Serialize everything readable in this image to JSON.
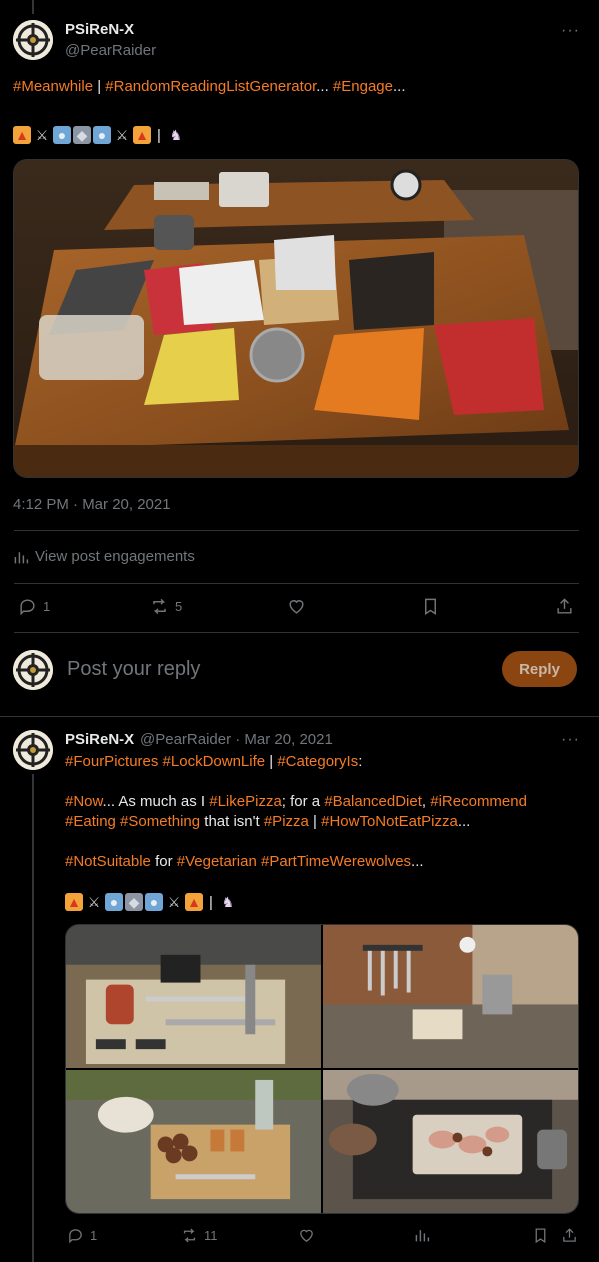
{
  "main_post": {
    "display_name": "PSiReN-X",
    "handle": "@PearRaider",
    "text_line1": [
      {
        "t": "#Meanwhile",
        "tag": true
      },
      {
        "t": " | ",
        "tag": false
      },
      {
        "t": "#RandomReadingListGenerator",
        "tag": true
      },
      {
        "t": "... ",
        "tag": false
      },
      {
        "t": "#Engage",
        "tag": true
      },
      {
        "t": "...",
        "tag": false
      }
    ],
    "timestamp": "4:12 PM · Mar 20, 2021",
    "engagements_label": "View post engagements",
    "reply_count": "1",
    "repost_count": "5"
  },
  "reply_box": {
    "placeholder": "Post your reply",
    "button_label": "Reply"
  },
  "reply_post": {
    "display_name": "PSiReN-X",
    "handle_date": "@PearRaider · Mar 20, 2021",
    "line1": [
      {
        "t": "#FourPictures",
        "tag": true
      },
      {
        "t": " ",
        "tag": false
      },
      {
        "t": "#LockDownLife",
        "tag": true
      },
      {
        "t": " | ",
        "tag": false
      },
      {
        "t": "#CategoryIs",
        "tag": true
      },
      {
        "t": ":",
        "tag": false
      }
    ],
    "line2": [
      {
        "t": "#Now",
        "tag": true
      },
      {
        "t": "... As much as I ",
        "tag": false
      },
      {
        "t": "#LikePizza",
        "tag": true
      },
      {
        "t": "; for a ",
        "tag": false
      },
      {
        "t": "#BalancedDiet",
        "tag": true
      },
      {
        "t": ", ",
        "tag": false
      },
      {
        "t": "#iRecommend",
        "tag": true
      }
    ],
    "line3": [
      {
        "t": "#Eating",
        "tag": true
      },
      {
        "t": " ",
        "tag": false
      },
      {
        "t": "#Something",
        "tag": true
      },
      {
        "t": " that isn't ",
        "tag": false
      },
      {
        "t": "#Pizza",
        "tag": true
      },
      {
        "t": " | ",
        "tag": false
      },
      {
        "t": "#HowToNotEatPizza",
        "tag": true
      },
      {
        "t": "...",
        "tag": false
      }
    ],
    "line4": [
      {
        "t": "#NotSuitable",
        "tag": true
      },
      {
        "t": " for ",
        "tag": false
      },
      {
        "t": "#Vegetarian",
        "tag": true
      },
      {
        "t": " ",
        "tag": false
      },
      {
        "t": "#PartTimeWerewolves",
        "tag": true
      },
      {
        "t": "...",
        "tag": false
      }
    ],
    "reply_count": "1",
    "repost_count": "11"
  },
  "emoji_sequence": [
    "fire-icon",
    "crossed-swords-icon",
    "robot-icon",
    "wolf-icon",
    "robot-icon",
    "crossed-swords-icon",
    "fire-icon",
    "pipe",
    "unicorn-icon"
  ],
  "colors": {
    "accent": "#f57c25",
    "reply_button": "#8a4510",
    "muted": "#71767b",
    "border": "#2f3336"
  }
}
